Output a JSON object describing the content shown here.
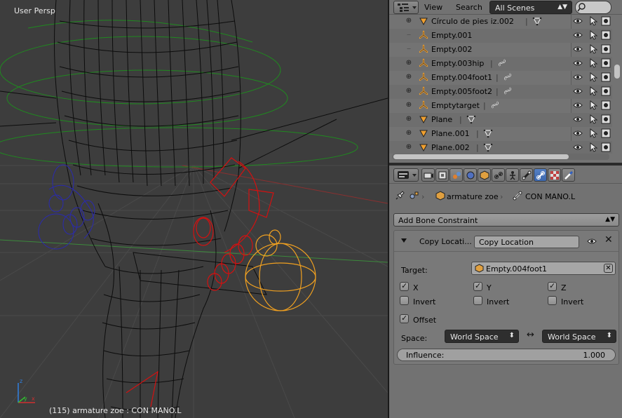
{
  "viewport": {
    "label": "User Persp",
    "status": "(115) armature zoe : CON MANO.L"
  },
  "outliner": {
    "menu": [
      "View",
      "Search"
    ],
    "scene_selector": "All Scenes",
    "rows": [
      {
        "name": "Círculo de  pies iz.002",
        "icon": "mesh-triangle-icon",
        "data_icon": "mesh-data-icon",
        "expandable": true
      },
      {
        "name": "Empty.001",
        "icon": "empty-axes-icon",
        "data_icon": "",
        "expandable": false
      },
      {
        "name": "Empty.002",
        "icon": "empty-axes-icon",
        "data_icon": "",
        "expandable": false
      },
      {
        "name": "Empty.003hip",
        "icon": "empty-axes-icon",
        "data_icon": "constraint-link-icon",
        "expandable": true
      },
      {
        "name": "Empty.004foot1",
        "icon": "empty-axes-icon",
        "data_icon": "constraint-link-icon",
        "expandable": true
      },
      {
        "name": "Empty.005foot2",
        "icon": "empty-axes-icon",
        "data_icon": "constraint-link-icon",
        "expandable": true
      },
      {
        "name": "Emptytarget",
        "icon": "empty-axes-icon",
        "data_icon": "constraint-link-icon",
        "expandable": true
      },
      {
        "name": "Plane",
        "icon": "mesh-triangle-icon",
        "data_icon": "mesh-data-icon",
        "expandable": true
      },
      {
        "name": "Plane.001",
        "icon": "mesh-triangle-icon",
        "data_icon": "mesh-data-icon",
        "expandable": true
      },
      {
        "name": "Plane.002",
        "icon": "mesh-triangle-icon",
        "data_icon": "mesh-data-icon",
        "expandable": true
      }
    ]
  },
  "properties": {
    "breadcrumb": {
      "object": "armature zoe",
      "bone": "CON MANO.L"
    },
    "add_constraint_label": "Add Bone Constraint",
    "constraint": {
      "type_label": "Copy Locati...",
      "name": "Copy Location",
      "target_label": "Target:",
      "target_value": "Empty.004foot1",
      "axes": [
        {
          "label": "X",
          "checked": true
        },
        {
          "label": "Y",
          "checked": true
        },
        {
          "label": "Z",
          "checked": true
        }
      ],
      "invert": [
        {
          "label": "Invert",
          "checked": false
        },
        {
          "label": "Invert",
          "checked": false
        },
        {
          "label": "Invert",
          "checked": false
        }
      ],
      "offset": {
        "label": "Offset",
        "checked": true
      },
      "space_label": "Space:",
      "owner_space": "World Space",
      "target_space": "World Space",
      "influence_label": "Influence:",
      "influence_value": "1.000"
    }
  },
  "colors": {
    "active_context": "#4a72b8",
    "bone_red": "#d01010",
    "bone_orange": "#f0a020",
    "bone_blue": "#2020a0"
  }
}
